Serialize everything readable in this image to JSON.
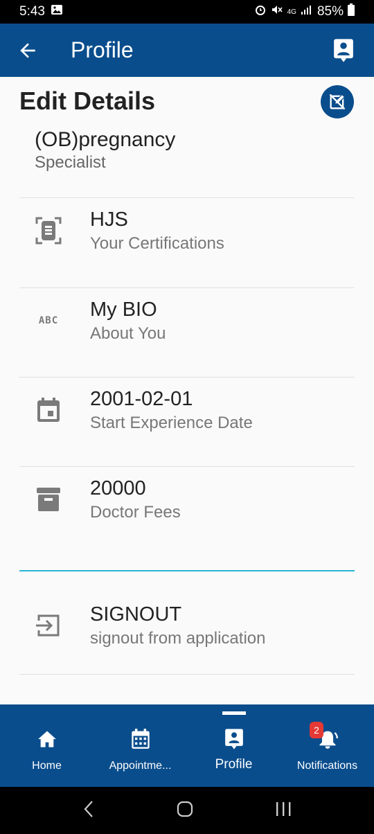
{
  "status_bar": {
    "time": "5:43",
    "battery": "85%"
  },
  "app_bar": {
    "title": "Profile"
  },
  "page": {
    "edit_title": "Edit Details",
    "specialization": {
      "title": "(OB)pregnancy",
      "subtitle": "Specialist"
    },
    "rows": [
      {
        "icon": "certificate-icon",
        "title": "HJS",
        "subtitle": "Your Certifications"
      },
      {
        "icon": "abc-icon",
        "icon_text": "ABC",
        "title": "My BIO",
        "subtitle": "About You"
      },
      {
        "icon": "calendar-icon",
        "title": "2001-02-01",
        "subtitle": "Start Experience Date"
      },
      {
        "icon": "archive-icon",
        "title": "20000",
        "subtitle": "Doctor Fees"
      }
    ],
    "signout": {
      "icon": "signout-icon",
      "title": "SIGNOUT",
      "subtitle": "signout from application"
    }
  },
  "bottom_nav": {
    "items": [
      {
        "icon": "home-icon",
        "label": "Home"
      },
      {
        "icon": "calendar-icon",
        "label": "Appointme..."
      },
      {
        "icon": "profile-icon",
        "label": "Profile",
        "active": true
      },
      {
        "icon": "bell-icon",
        "label": "Notifications",
        "badge": "2"
      }
    ]
  },
  "colors": {
    "primary": "#0a4d8c",
    "accent_divider": "#29b6d6",
    "badge": "#e53935"
  }
}
